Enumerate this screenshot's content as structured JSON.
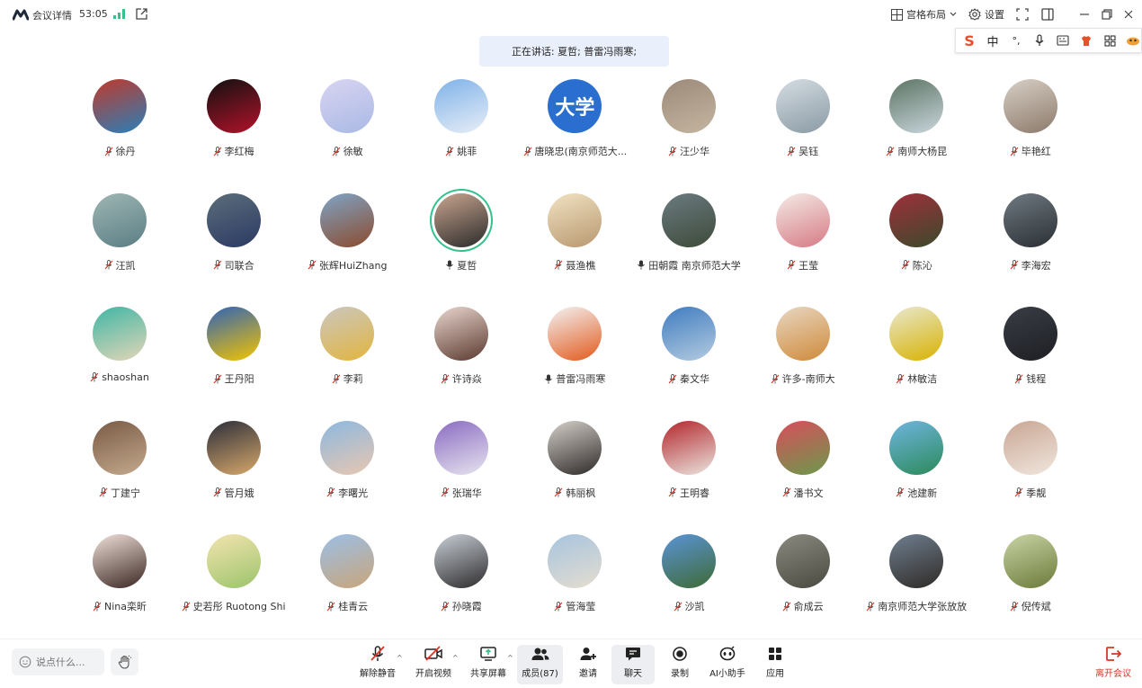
{
  "topbar": {
    "meeting_info_label": "会议详情",
    "timer": "53:05",
    "layout_label": "宫格布局",
    "settings_label": "设置"
  },
  "ime": {
    "brand": "S",
    "mode": "中",
    "punct": "°,"
  },
  "speaking": {
    "text": "正在讲话: 夏哲; 普雷冯雨寒;"
  },
  "participants": [
    {
      "name": "徐丹",
      "mic": "muted",
      "color": "#c0392b",
      "color2": "#2980b9"
    },
    {
      "name": "李红梅",
      "mic": "muted",
      "color": "#111111",
      "color2": "#b3122a"
    },
    {
      "name": "徐敏",
      "mic": "muted",
      "color": "#d9d4f2",
      "color2": "#a9b9e4"
    },
    {
      "name": "姚菲",
      "mic": "muted",
      "color": "#7fb2e8",
      "color2": "#e8eef7"
    },
    {
      "name": "唐晓忠(南京师范大...",
      "mic": "muted",
      "color": "#2a6fd0",
      "color2": "#2a6fd0",
      "text": "大学"
    },
    {
      "name": "汪少华",
      "mic": "muted",
      "color": "#9c8a7a",
      "color2": "#c4b5a0"
    },
    {
      "name": "吴钰",
      "mic": "muted",
      "color": "#d5dde3",
      "color2": "#8a9aa4"
    },
    {
      "name": "南师大杨昆",
      "mic": "muted",
      "color": "#5c7463",
      "color2": "#c9d6dd"
    },
    {
      "name": "毕艳红",
      "mic": "muted",
      "color": "#d8cfc5",
      "color2": "#8c7a6b"
    },
    {
      "name": "汪凯",
      "mic": "muted",
      "color": "#9fb6b4",
      "color2": "#5a7e84"
    },
    {
      "name": "司联合",
      "mic": "muted",
      "color": "#5c6d7b",
      "color2": "#2b3a63"
    },
    {
      "name": "张辉HuiZhang",
      "mic": "muted",
      "color": "#7fa4c5",
      "color2": "#8b4b2e"
    },
    {
      "name": "夏哲",
      "mic": "on",
      "color": "#c9a58f",
      "color2": "#2b2b2b",
      "active": true
    },
    {
      "name": "聂渔樵",
      "mic": "muted",
      "color": "#f1e2c2",
      "color2": "#b89870"
    },
    {
      "name": "田朝霞 南京师范大学",
      "mic": "on",
      "color": "#6b7a80",
      "color2": "#3d4b3a"
    },
    {
      "name": "王莹",
      "mic": "muted",
      "color": "#f4ebe6",
      "color2": "#d67a84"
    },
    {
      "name": "陈沁",
      "mic": "muted",
      "color": "#9f2f3c",
      "color2": "#3b4a2b"
    },
    {
      "name": "李海宏",
      "mic": "muted",
      "color": "#6f7a80",
      "color2": "#2a2f35"
    },
    {
      "name": "shaoshan",
      "mic": "muted",
      "color": "#3fb6a5",
      "color2": "#e3d6b7"
    },
    {
      "name": "王丹阳",
      "mic": "muted",
      "color": "#2f63b8",
      "color2": "#f3c400"
    },
    {
      "name": "李莉",
      "mic": "muted",
      "color": "#cbc7bf",
      "color2": "#e2b53f"
    },
    {
      "name": "许诗焱",
      "mic": "muted",
      "color": "#e9d6cf",
      "color2": "#5b3a2f"
    },
    {
      "name": "普雷冯雨寒",
      "mic": "on",
      "color": "#f3f3f3",
      "color2": "#e25a1d"
    },
    {
      "name": "秦文华",
      "mic": "muted",
      "color": "#3f7cc0",
      "color2": "#b4cbe0"
    },
    {
      "name": "许多-南师大",
      "mic": "muted",
      "color": "#e7d7c2",
      "color2": "#d08a3a"
    },
    {
      "name": "林敏洁",
      "mic": "muted",
      "color": "#e8e8d0",
      "color2": "#d8b200"
    },
    {
      "name": "钱程",
      "mic": "muted",
      "color": "#3a3d45",
      "color2": "#1d1f24"
    },
    {
      "name": "丁建宁",
      "mic": "muted",
      "color": "#7a5b46",
      "color2": "#c4a98d"
    },
    {
      "name": "管月娥",
      "mic": "muted",
      "color": "#2b2e3a",
      "color2": "#d8a86a"
    },
    {
      "name": "李曙光",
      "mic": "muted",
      "color": "#8cb8e0",
      "color2": "#e8c7b0"
    },
    {
      "name": "张瑞华",
      "mic": "muted",
      "color": "#8a6bc2",
      "color2": "#e7e4ee"
    },
    {
      "name": "韩丽枫",
      "mic": "muted",
      "color": "#d6d0ca",
      "color2": "#2e2a28"
    },
    {
      "name": "王明睿",
      "mic": "muted",
      "color": "#b3262c",
      "color2": "#eae5df"
    },
    {
      "name": "潘书文",
      "mic": "muted",
      "color": "#d94d5c",
      "color2": "#6b9a4b"
    },
    {
      "name": "池建新",
      "mic": "muted",
      "color": "#6fb5e0",
      "color2": "#2b8a5a"
    },
    {
      "name": "季靓",
      "mic": "muted",
      "color": "#c9a694",
      "color2": "#f0e6dd"
    },
    {
      "name": "Nina栾昕",
      "mic": "muted",
      "color": "#f1e1da",
      "color2": "#3a2622"
    },
    {
      "name": "史若彤 Ruotong Shi",
      "mic": "muted",
      "color": "#f4e4b0",
      "color2": "#9bc46b"
    },
    {
      "name": "桂青云",
      "mic": "muted",
      "color": "#9bbfe6",
      "color2": "#c9a57a"
    },
    {
      "name": "孙晓霞",
      "mic": "muted",
      "color": "#c8cfd6",
      "color2": "#2d2b2d"
    },
    {
      "name": "管海莹",
      "mic": "muted",
      "color": "#a7c4de",
      "color2": "#e4ddd0"
    },
    {
      "name": "沙凯",
      "mic": "muted",
      "color": "#5a94d6",
      "color2": "#3e6a36"
    },
    {
      "name": "俞成云",
      "mic": "muted",
      "color": "#8a8a80",
      "color2": "#4a4a40"
    },
    {
      "name": "南京师范大学张放放",
      "mic": "muted",
      "color": "#6f7f90",
      "color2": "#2f2a26"
    },
    {
      "name": "倪传斌",
      "mic": "muted",
      "color": "#c9d4a5",
      "color2": "#6b7a3a"
    }
  ],
  "toolbar": {
    "chat_placeholder": "说点什么...",
    "unmute_label": "解除静音",
    "video_label": "开启视频",
    "share_label": "共享屏幕",
    "members_label": "成员(87)",
    "invite_label": "邀请",
    "chat_label": "聊天",
    "record_label": "录制",
    "ai_label": "AI小助手",
    "apps_label": "应用",
    "leave_label": "离开会议"
  },
  "colors": {
    "accent": "#35c08c",
    "leave": "#d13a28",
    "banner": "#e9effb"
  }
}
